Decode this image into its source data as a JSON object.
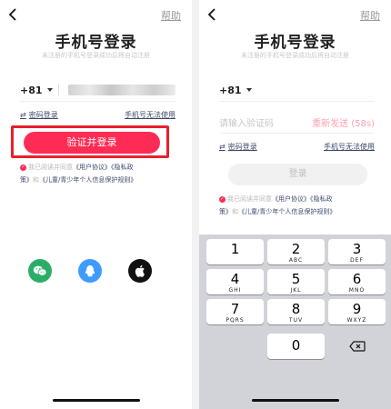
{
  "left": {
    "help": "帮助",
    "title": "手机号登录",
    "subtitle": "未注册的手机号登录成功后将自动注册",
    "country_code": "+81",
    "password_login": "密码登录",
    "phone_unavailable": "手机号无法使用",
    "primary_button": "验证并登录",
    "agree_prefix": "我已阅读并同意",
    "user_agreement": "《用户协议》",
    "privacy_a": "《隐私政",
    "privacy_b": "策》",
    "and": "和",
    "minor_policy": "《儿童/青少年个人信息保护规则》",
    "social_icons": [
      "wechat-icon",
      "qq-icon",
      "apple-icon"
    ]
  },
  "right": {
    "help": "帮助",
    "title": "手机号登录",
    "subtitle": "未注册的手机号登录成功后将自动注册",
    "country_code": "+81",
    "code_placeholder": "请输入验证码",
    "resend": "重新发送 (58s)",
    "password_login": "密码登录",
    "phone_unavailable": "手机号无法使用",
    "login_button": "登录",
    "agree_prefix": "我已阅读并同意",
    "user_agreement": "《用户协议》",
    "privacy": "《隐私政",
    "privacy_b": "策》",
    "and": "和",
    "minor_policy": "《儿童/青少年个人信息保护规则》",
    "keys": [
      {
        "digit": "1",
        "letters": ""
      },
      {
        "digit": "2",
        "letters": "ABC"
      },
      {
        "digit": "3",
        "letters": "DEF"
      },
      {
        "digit": "4",
        "letters": "GHI"
      },
      {
        "digit": "5",
        "letters": "JKL"
      },
      {
        "digit": "6",
        "letters": "MNO"
      },
      {
        "digit": "7",
        "letters": "PQRS"
      },
      {
        "digit": "8",
        "letters": "TUV"
      },
      {
        "digit": "9",
        "letters": "WXYZ"
      },
      {
        "digit": "0",
        "letters": ""
      }
    ]
  },
  "colors": {
    "accent": "#fe2c55",
    "highlight": "#e8202c",
    "link": "#3d4a6b",
    "wechat": "#2aae67",
    "qq": "#3f9bff",
    "apple": "#111111"
  }
}
